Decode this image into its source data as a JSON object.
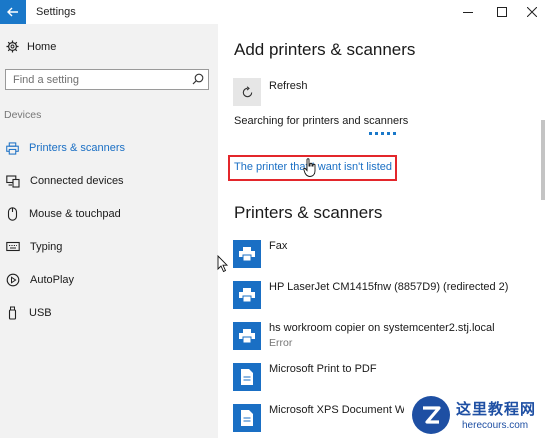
{
  "window": {
    "title": "Settings"
  },
  "sidebar": {
    "home_label": "Home",
    "search_placeholder": "Find a setting",
    "section_label": "Devices",
    "items": [
      {
        "label": "Printers & scanners",
        "icon": "printer-icon",
        "active": true
      },
      {
        "label": "Connected devices",
        "icon": "connected-devices-icon",
        "active": false
      },
      {
        "label": "Mouse & touchpad",
        "icon": "mouse-icon",
        "active": false
      },
      {
        "label": "Typing",
        "icon": "keyboard-icon",
        "active": false
      },
      {
        "label": "AutoPlay",
        "icon": "autoplay-icon",
        "active": false
      },
      {
        "label": "USB",
        "icon": "usb-icon",
        "active": false
      }
    ]
  },
  "main": {
    "add_heading": "Add printers & scanners",
    "refresh_label": "Refresh",
    "searching_text": "Searching for printers and scanners",
    "not_listed_link": "The printer that I want isn't listed",
    "printers_heading": "Printers & scanners",
    "printers": [
      {
        "name": "Fax",
        "status": ""
      },
      {
        "name": "HP LaserJet CM1415fnw (8857D9) (redirected 2)",
        "status": ""
      },
      {
        "name": "hs workroom copier on systemcenter2.stj.local",
        "status": "Error"
      },
      {
        "name": "Microsoft Print to PDF",
        "status": ""
      },
      {
        "name": "Microsoft XPS Document Wri",
        "status": ""
      }
    ]
  },
  "watermark": {
    "cn": "这里教程网",
    "en": "herecours.com"
  },
  "colors": {
    "accent": "#1a78c9",
    "link": "#1a6fc4",
    "highlight_box": "#e3262b",
    "sidebar_bg": "#f2f2f2"
  }
}
